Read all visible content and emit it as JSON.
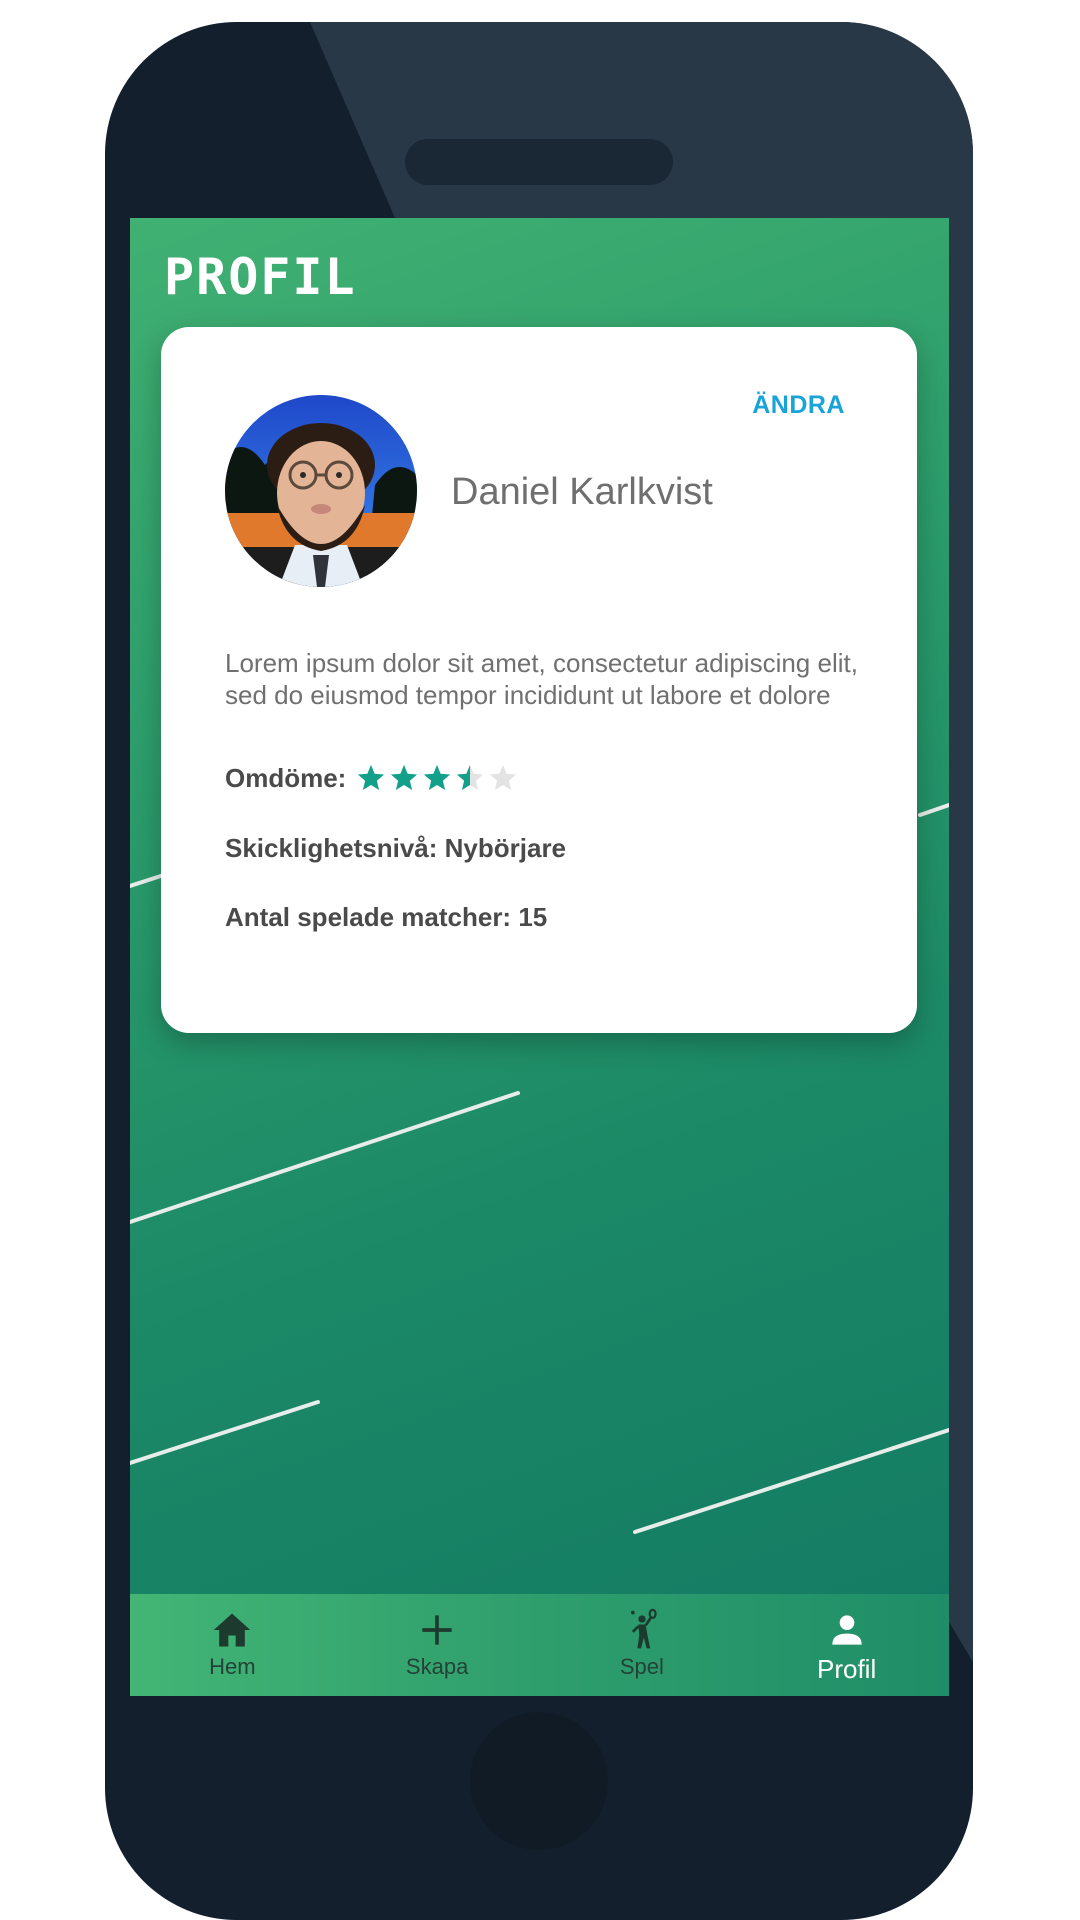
{
  "header": {
    "title": "PROFIL"
  },
  "profile": {
    "edit_label": "ÄNDRA",
    "name": "Daniel Karlkvist",
    "bio": "Lorem ipsum dolor sit amet, consectetur adipiscing elit, sed do eiusmod tempor incididunt ut labore et dolore",
    "rating_label": "Omdöme:",
    "rating_value": 3.5,
    "rating_max": 5,
    "skill_text": "Skicklighetsnivå: Nybörjare",
    "matches_text": "Antal spelade matcher: 15"
  },
  "nav": {
    "items": [
      {
        "label": "Hem",
        "icon": "home-icon"
      },
      {
        "label": "Skapa",
        "icon": "plus-icon"
      },
      {
        "label": "Spel",
        "icon": "tennis-player-icon"
      },
      {
        "label": "Profil",
        "icon": "person-icon",
        "active": true
      }
    ]
  },
  "colors": {
    "accent": "#1aa3d8",
    "star_filled": "#12a08b",
    "star_empty": "#e3e3e3",
    "gradient_start": "#41b072",
    "gradient_end": "#137a63"
  }
}
